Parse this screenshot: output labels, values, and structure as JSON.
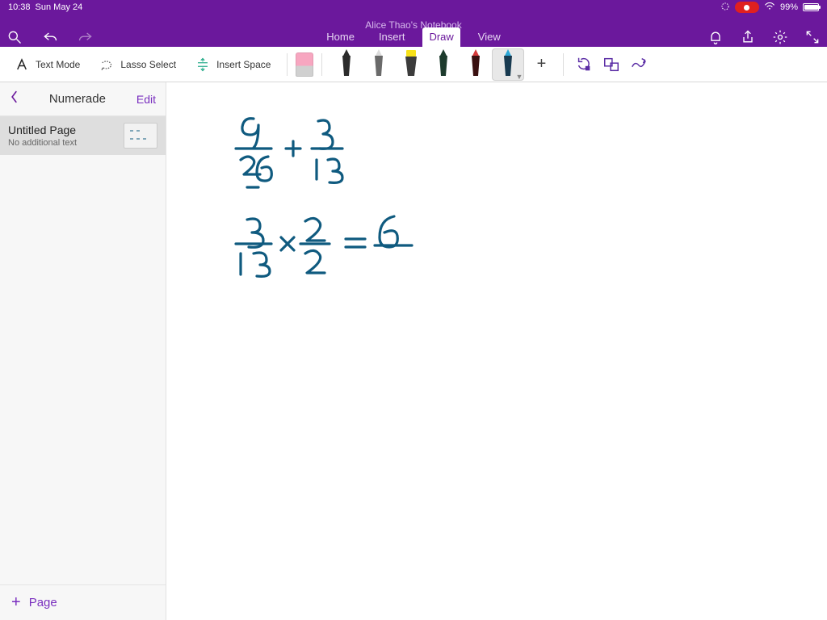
{
  "status": {
    "time": "10:38",
    "date": "Sun May 24",
    "battery_pct": "99%"
  },
  "header": {
    "notebook_title": "Alice Thao's Notebook",
    "tabs": {
      "home": "Home",
      "insert": "Insert",
      "draw": "Draw",
      "view": "View"
    }
  },
  "toolbar": {
    "text_mode": "Text Mode",
    "lasso_select": "Lasso Select",
    "insert_space": "Insert Space",
    "pens": [
      {
        "name": "pen-black-fine",
        "body": "#2b2b2b",
        "tip": "#2b2b2b",
        "shape": "pen"
      },
      {
        "name": "pen-gray",
        "body": "#6a6a6a",
        "tip": "#dcdcdc",
        "shape": "pen"
      },
      {
        "name": "highlighter-yel",
        "body": "#3c3c3c",
        "tip": "#f7e11a",
        "shape": "highlighter"
      },
      {
        "name": "pen-dark-green",
        "body": "#1d3b2d",
        "tip": "#1d3b2d",
        "shape": "pen"
      },
      {
        "name": "pen-red",
        "body": "#3a1010",
        "tip": "#d63a3a",
        "shape": "pen"
      },
      {
        "name": "pen-blue",
        "body": "#183a50",
        "tip": "#2aa6d6",
        "shape": "pen",
        "selected": true
      }
    ]
  },
  "sidebar": {
    "section_name": "Numerade",
    "edit_label": "Edit",
    "page": {
      "title": "Untitled Page",
      "subtitle": "No additional text"
    },
    "add_page_label": "Page"
  },
  "handwriting": {
    "description": "9/26 + 3/13 ; 3/13 × 2/2 = 6/",
    "expr1": {
      "a_num": "9",
      "a_den": "26",
      "op": "+",
      "b_num": "3",
      "b_den": "13"
    },
    "expr2": {
      "a_num": "3",
      "a_den": "13",
      "op": "×",
      "b_num": "2",
      "b_den": "2",
      "eq": "=",
      "r_num": "6"
    }
  },
  "colors": {
    "brand_purple": "#6b189c",
    "accent_purple": "#7a2fbf",
    "ink_blue": "#0f5a7f"
  }
}
